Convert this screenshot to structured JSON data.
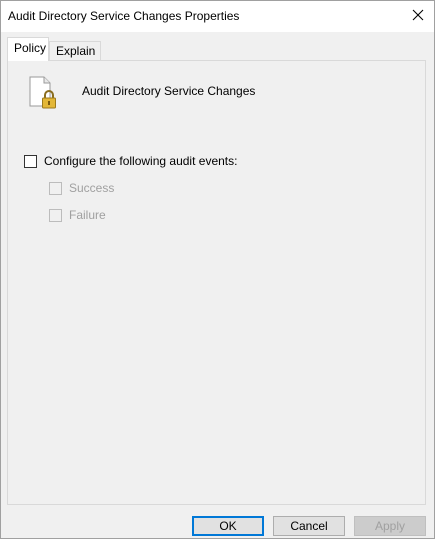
{
  "window": {
    "title": "Audit Directory Service Changes Properties"
  },
  "tabs": [
    {
      "label": "Policy",
      "active": true
    },
    {
      "label": "Explain",
      "active": false
    }
  ],
  "policy": {
    "name": "Audit Directory Service Changes",
    "icon": "policy-document-lock-icon"
  },
  "checkboxes": {
    "configure": {
      "label": "Configure the following audit events:",
      "checked": false,
      "enabled": true
    },
    "success": {
      "label": "Success",
      "checked": false,
      "enabled": false
    },
    "failure": {
      "label": "Failure",
      "checked": false,
      "enabled": false
    }
  },
  "buttons": {
    "ok": "OK",
    "cancel": "Cancel",
    "apply": "Apply"
  },
  "colors": {
    "focus_border": "#0078d7",
    "disabled_text": "#a0a0a0",
    "dialog_bg": "#f0f0f0"
  }
}
